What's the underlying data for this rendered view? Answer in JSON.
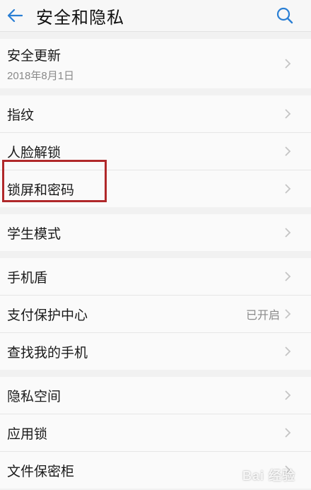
{
  "header": {
    "title": "安全和隐私",
    "back_icon": "arrow-left-icon",
    "search_icon": "search-icon",
    "accent": "#2a7fd4"
  },
  "groups": [
    {
      "items": [
        {
          "label": "安全更新",
          "sub": "2018年8月1日"
        }
      ]
    },
    {
      "items": [
        {
          "label": "指纹"
        },
        {
          "label": "人脸解锁"
        },
        {
          "label": "锁屏和密码"
        }
      ]
    },
    {
      "items": [
        {
          "label": "学生模式"
        }
      ]
    },
    {
      "items": [
        {
          "label": "手机盾"
        },
        {
          "label": "支付保护中心",
          "status": "已开启"
        },
        {
          "label": "查找我的手机"
        }
      ]
    },
    {
      "items": [
        {
          "label": "隐私空间"
        },
        {
          "label": "应用锁"
        },
        {
          "label": "文件保密柜"
        }
      ]
    }
  ],
  "highlight_color": "#b0282a",
  "watermark": "Bai 经验"
}
